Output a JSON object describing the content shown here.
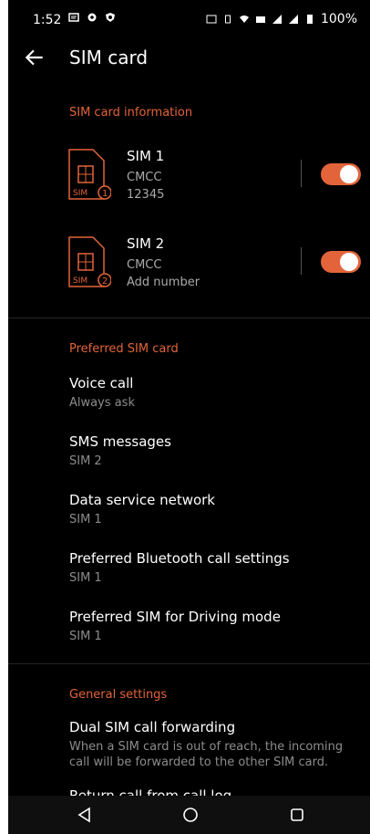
{
  "status_bar": {
    "time": "1:52",
    "battery": "100%",
    "left_icons": [
      "message-icon",
      "gear-icon",
      "shield-icon"
    ],
    "right_icons": [
      "nfc-icon",
      "vibrate-icon",
      "wifi-icon",
      "lte-icon",
      "signal-icon",
      "signal-icon",
      "battery-icon"
    ]
  },
  "app_bar": {
    "title": "SIM card"
  },
  "sim_info": {
    "header": "SIM card information",
    "sims": [
      {
        "name": "SIM 1",
        "carrier": "CMCC",
        "number": "12345",
        "enabled": true,
        "badge": "1"
      },
      {
        "name": "SIM 2",
        "carrier": "CMCC",
        "number": "Add number",
        "enabled": true,
        "badge": "2"
      }
    ]
  },
  "preferred": {
    "header": "Preferred SIM card",
    "items": [
      {
        "title": "Voice call",
        "value": "Always ask"
      },
      {
        "title": "SMS messages",
        "value": "SIM 2"
      },
      {
        "title": "Data service network",
        "value": "SIM 1"
      },
      {
        "title": "Preferred Bluetooth call settings",
        "value": "SIM 1"
      },
      {
        "title": "Preferred SIM for Driving mode",
        "value": "SIM 1"
      }
    ]
  },
  "general": {
    "header": "General settings",
    "items": [
      {
        "title": "Dual SIM call forwarding",
        "value": "When a SIM card is out of reach, the incoming call will be forwarded to the other SIM card."
      },
      {
        "title": "Return call from call log",
        "value": ""
      }
    ]
  },
  "colors": {
    "accent": "#e3643a",
    "background": "#000000"
  }
}
